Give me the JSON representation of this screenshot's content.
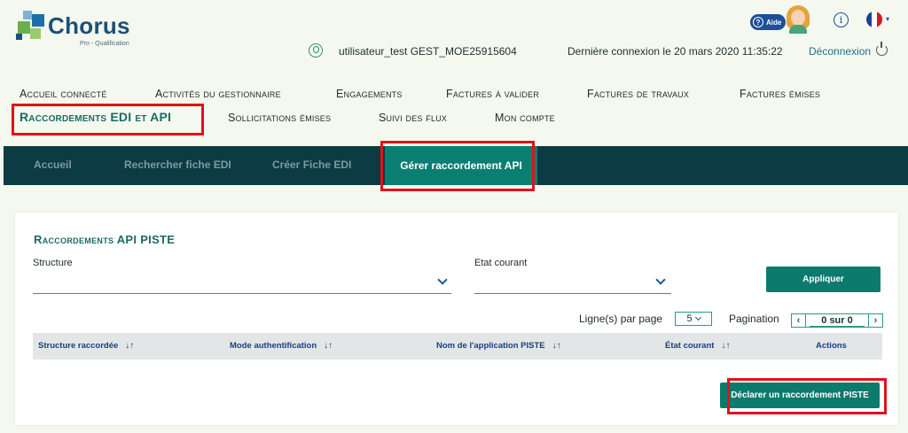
{
  "header": {
    "brand": "Chorus",
    "brand_sub": "Pro - Qualification",
    "aide_label": "Aide",
    "username": "utilisateur_test GEST_MOE25915604",
    "last_login": "Dernière connexion le 20 mars 2020 11:35:22",
    "logout_label": "Déconnexion",
    "info_glyph": "i",
    "flag_caret": "▾"
  },
  "nav": {
    "row1": [
      "Accueil connecté",
      "Activités du gestionnaire",
      "Engagements",
      "Factures à valider",
      "Factures de travaux",
      "Factures émises"
    ],
    "row2": [
      "Raccordements EDI et API",
      "Sollicitations émises",
      "Suivi des flux",
      "Mon compte"
    ],
    "active": "Raccordements EDI et API"
  },
  "subnav": {
    "items": [
      "Accueil",
      "Rechercher fiche EDI",
      "Créer Fiche EDI"
    ],
    "active": "Gérer raccordement API"
  },
  "panel": {
    "title": "Raccordements API PISTE",
    "structure_label": "Structure",
    "structure_value": "",
    "etat_label": "Etat courant",
    "etat_value": "",
    "apply_button": "Appliquer",
    "lines_per_page_label": "Ligne(s) par page",
    "lines_per_page_value": "5",
    "pagination_label": "Pagination",
    "pagination_value": "0 sur 0",
    "prev_glyph": "‹",
    "next_glyph": "›",
    "sort_glyph": "↓↑",
    "columns": [
      "Structure raccordée",
      "Mode authentification",
      "Nom de l'application PISTE",
      "État courant"
    ],
    "actions_header": "Actions",
    "declare_button": "Déclarer un raccordement PISTE"
  },
  "colors": {
    "accent": "#0d7a6e",
    "subnav_bg": "#0c3b43",
    "highlight": "#e0121c",
    "page_bg": "#f4f8ee"
  },
  "icons": [
    "user-icon",
    "power-icon",
    "help-icon",
    "info-icon",
    "flag-fr-icon",
    "chevron-down-icon",
    "sort-icon"
  ]
}
